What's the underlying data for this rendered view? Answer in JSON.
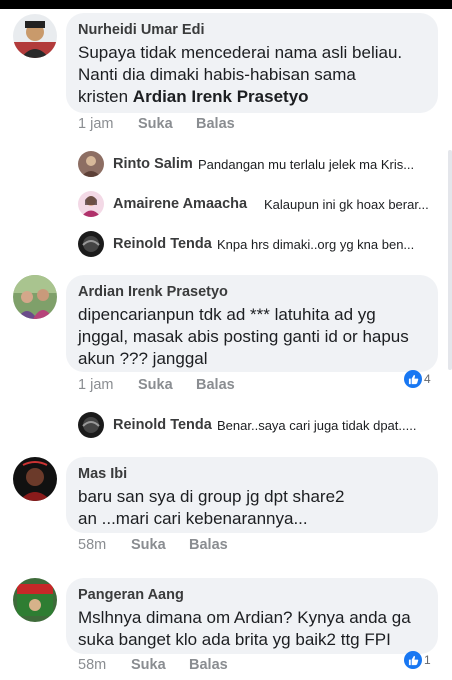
{
  "comments": [
    {
      "name": "Nurheidi Umar Edi",
      "text_lines": [
        "Supaya  tidak  mencederai  nama asli beliau.",
        "Nanti dia  dimaki habis-habisan sama",
        "kristen "
      ],
      "mention": "Ardian Irenk Prasetyo",
      "time": "1 jam",
      "like": "Suka",
      "reply": "Balas"
    },
    {
      "name": "Ardian Irenk Prasetyo",
      "text_lines": [
        "dipencarianpun tdk ad *** latuhita ad yg",
        "jnggal, masak abis posting ganti id or hapus",
        "akun ??? janggal"
      ],
      "time": "1 jam",
      "like": "Suka",
      "reply": "Balas",
      "reaction_count": "4"
    },
    {
      "name": "Mas Ibi",
      "text_lines": [
        "baru san sya di group jg dpt share2",
        "an ...mari cari kebenarannya..."
      ],
      "time": "58m",
      "like": "Suka",
      "reply": "Balas"
    },
    {
      "name": "Pangeran Aang",
      "text_lines": [
        "Mslhnya dimana om Ardian? Kynya anda ga",
        "suka banget klo ada brita yg baik2 ttg FPI"
      ],
      "time": "58m",
      "like": "Suka",
      "reply": "Balas",
      "reaction_count": "1"
    }
  ],
  "replies": [
    {
      "name": "Rinto Salim",
      "text": "Pandangan mu terlalu jelek ma Kris..."
    },
    {
      "name": "Amairene Amaacha",
      "text": "Kalaupun  ini gk hoax berar..."
    },
    {
      "name": "Reinold Tenda",
      "text": "Knpa hrs dimaki..org yg kna ben..."
    },
    {
      "name": "Reinold Tenda",
      "text": "Benar..saya cari juga tidak dpat....."
    }
  ],
  "colors": {
    "bubble": "#f0f2f5",
    "like_blue": "#1877f2",
    "muted": "#8a8d91"
  },
  "icons": {
    "reaction": "thumbs-up-icon"
  }
}
